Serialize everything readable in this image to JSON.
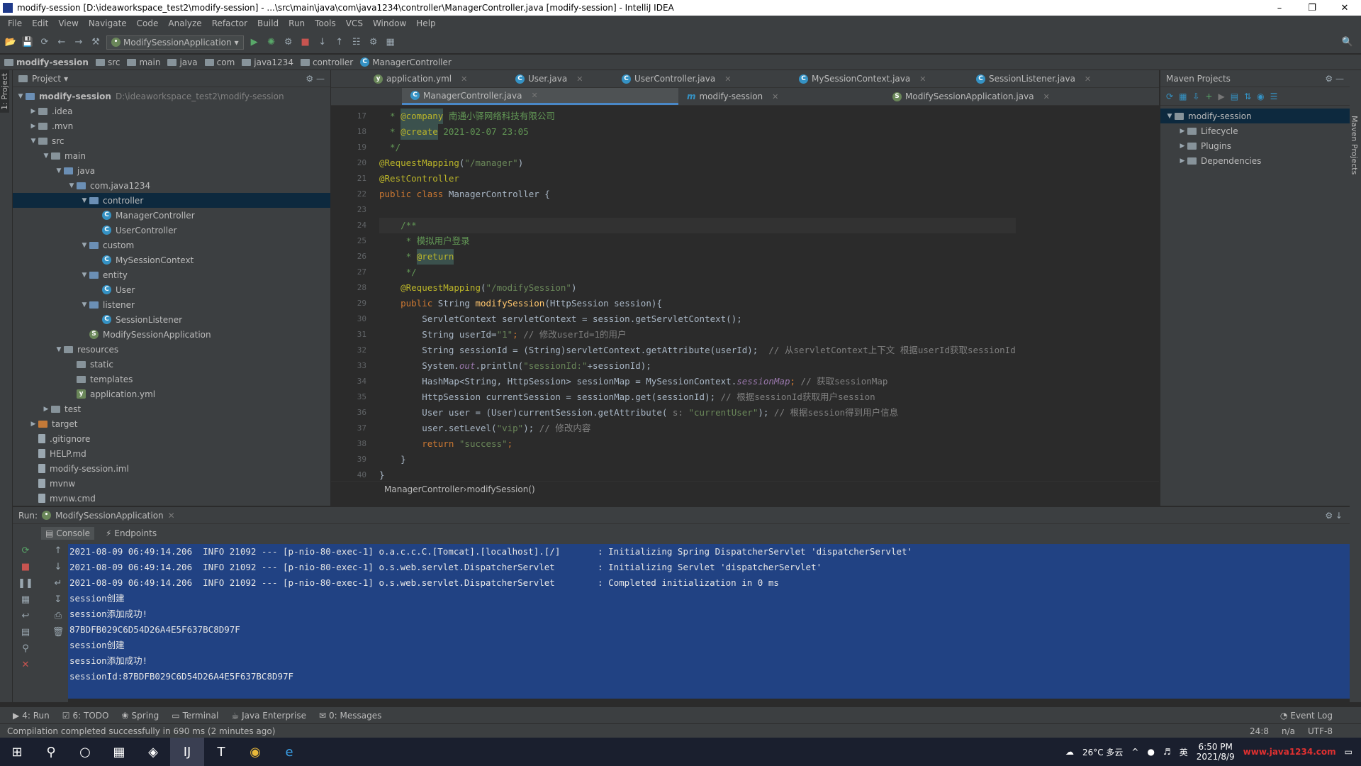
{
  "window": {
    "title": "modify-session [D:\\ideaworkspace_test2\\modify-session] - ...\\src\\main\\java\\com\\java1234\\controller\\ManagerController.java [modify-session] - IntelliJ IDEA"
  },
  "menu": [
    "File",
    "Edit",
    "View",
    "Navigate",
    "Code",
    "Analyze",
    "Refactor",
    "Build",
    "Run",
    "Tools",
    "VCS",
    "Window",
    "Help"
  ],
  "toolbar": {
    "run_config": "ModifySessionApplication"
  },
  "breadcrumbs": [
    "modify-session",
    "src",
    "main",
    "java",
    "com",
    "java1234",
    "controller",
    "ManagerController"
  ],
  "project": {
    "title": "Project",
    "tree": [
      {
        "label": "modify-session",
        "extra": "D:\\ideaworkspace_test2\\modify-session",
        "depth": 0,
        "type": "module",
        "open": true
      },
      {
        "label": ".idea",
        "depth": 1,
        "type": "folder",
        "open": false
      },
      {
        "label": ".mvn",
        "depth": 1,
        "type": "folder",
        "open": false
      },
      {
        "label": "src",
        "depth": 1,
        "type": "folder",
        "open": true
      },
      {
        "label": "main",
        "depth": 2,
        "type": "folder",
        "open": true
      },
      {
        "label": "java",
        "depth": 3,
        "type": "folder",
        "open": true
      },
      {
        "label": "com.java1234",
        "depth": 4,
        "type": "folder",
        "open": true
      },
      {
        "label": "controller",
        "depth": 5,
        "type": "folder",
        "open": true,
        "selected": true
      },
      {
        "label": "ManagerController",
        "depth": 6,
        "type": "class"
      },
      {
        "label": "UserController",
        "depth": 6,
        "type": "class"
      },
      {
        "label": "custom",
        "depth": 5,
        "type": "folder",
        "open": true
      },
      {
        "label": "MySessionContext",
        "depth": 6,
        "type": "class"
      },
      {
        "label": "entity",
        "depth": 5,
        "type": "folder",
        "open": true
      },
      {
        "label": "User",
        "depth": 6,
        "type": "class"
      },
      {
        "label": "listener",
        "depth": 5,
        "type": "folder",
        "open": true
      },
      {
        "label": "SessionListener",
        "depth": 6,
        "type": "class"
      },
      {
        "label": "ModifySessionApplication",
        "depth": 5,
        "type": "spring"
      },
      {
        "label": "resources",
        "depth": 3,
        "type": "folder",
        "open": true
      },
      {
        "label": "static",
        "depth": 4,
        "type": "folder"
      },
      {
        "label": "templates",
        "depth": 4,
        "type": "folder"
      },
      {
        "label": "application.yml",
        "depth": 4,
        "type": "yml"
      },
      {
        "label": "test",
        "depth": 2,
        "type": "folder",
        "open": false
      },
      {
        "label": "target",
        "depth": 1,
        "type": "target",
        "open": false
      },
      {
        "label": ".gitignore",
        "depth": 1,
        "type": "file"
      },
      {
        "label": "HELP.md",
        "depth": 1,
        "type": "file"
      },
      {
        "label": "modify-session.iml",
        "depth": 1,
        "type": "file"
      },
      {
        "label": "mvnw",
        "depth": 1,
        "type": "file"
      },
      {
        "label": "mvnw.cmd",
        "depth": 1,
        "type": "file"
      }
    ]
  },
  "tabs_row1": [
    {
      "label": "application.yml",
      "active": false
    },
    {
      "label": "User.java",
      "active": false
    },
    {
      "label": "UserController.java",
      "active": false
    },
    {
      "label": "MySessionContext.java",
      "active": false
    },
    {
      "label": "SessionListener.java",
      "active": false
    }
  ],
  "tabs_row2": [
    {
      "label": "ManagerController.java",
      "active": true
    },
    {
      "label": "modify-session",
      "active": false
    },
    {
      "label": "ModifySessionApplication.java",
      "active": false
    }
  ],
  "code": {
    "line_numbers": [
      "17",
      "18",
      "19",
      "20",
      "21",
      "22",
      "23",
      "24",
      "25",
      "26",
      "27",
      "28",
      "29",
      "30",
      "31",
      "32",
      "33",
      "34",
      "35",
      "36",
      "37",
      "38",
      "39",
      "40"
    ],
    "lines": [
      [
        {
          "t": "  * ",
          "c": "doc"
        },
        {
          "t": "@company",
          "c": "an"
        },
        {
          "t": " 南通小驿网络科技有限公司",
          "c": "doc"
        }
      ],
      [
        {
          "t": "  * ",
          "c": "doc"
        },
        {
          "t": "@create",
          "c": "an"
        },
        {
          "t": " 2021-02-07 23:05",
          "c": "doc"
        }
      ],
      [
        {
          "t": "  */",
          "c": "doc"
        }
      ],
      [
        {
          "t": "@RequestMapping",
          "c": "an"
        },
        {
          "t": "(",
          "c": ""
        },
        {
          "t": "\"/manager\"",
          "c": "s"
        },
        {
          "t": ")",
          "c": ""
        }
      ],
      [
        {
          "t": "@RestController",
          "c": "an"
        }
      ],
      [
        {
          "t": "public class ",
          "c": "k"
        },
        {
          "t": "ManagerController {",
          "c": ""
        }
      ],
      [
        {
          "t": "",
          "c": ""
        }
      ],
      [
        {
          "t": "    /**",
          "c": "doc"
        }
      ],
      [
        {
          "t": "     * 模拟用户登录",
          "c": "doc"
        }
      ],
      [
        {
          "t": "     * ",
          "c": "doc"
        },
        {
          "t": "@return",
          "c": "an"
        }
      ],
      [
        {
          "t": "     */",
          "c": "doc"
        }
      ],
      [
        {
          "t": "    @RequestMapping",
          "c": "an"
        },
        {
          "t": "(",
          "c": ""
        },
        {
          "t": "\"/modifySession\"",
          "c": "s"
        },
        {
          "t": ")",
          "c": ""
        }
      ],
      [
        {
          "t": "    public ",
          "c": "k"
        },
        {
          "t": "String ",
          "c": ""
        },
        {
          "t": "modifySession",
          "c": "fn"
        },
        {
          "t": "(HttpSession session){",
          "c": ""
        }
      ],
      [
        {
          "t": "        ServletContext servletContext = session.getServletContext();",
          "c": ""
        }
      ],
      [
        {
          "t": "        String userId=",
          "c": ""
        },
        {
          "t": "\"1\"",
          "c": "s"
        },
        {
          "t": "; ",
          "c": "k"
        },
        {
          "t": "// 修改userId=1的用户",
          "c": "cm"
        }
      ],
      [
        {
          "t": "        String sessionId = (String)servletContext.getAttribute(userId);  ",
          "c": ""
        },
        {
          "t": "// 从servletContext上下文 根据userId获取sessionId",
          "c": "cm"
        }
      ],
      [
        {
          "t": "        System.",
          "c": ""
        },
        {
          "t": "out",
          "c": "it"
        },
        {
          "t": ".println(",
          "c": ""
        },
        {
          "t": "\"sessionId:\"",
          "c": "s"
        },
        {
          "t": "+sessionId);",
          "c": ""
        }
      ],
      [
        {
          "t": "        HashMap<String, HttpSession> sessionMap = MySessionContext.",
          "c": ""
        },
        {
          "t": "sessionMap",
          "c": "it"
        },
        {
          "t": "; ",
          "c": "k"
        },
        {
          "t": "// 获取sessionMap",
          "c": "cm"
        }
      ],
      [
        {
          "t": "        HttpSession currentSession = sessionMap.get(sessionId); ",
          "c": ""
        },
        {
          "t": "// 根据sessionId获取用户session",
          "c": "cm"
        }
      ],
      [
        {
          "t": "        User user = (User)currentSession.getAttribute( ",
          "c": ""
        },
        {
          "t": "s:",
          "c": "cm"
        },
        {
          "t": " \"currentUser\"",
          "c": "s"
        },
        {
          "t": "); ",
          "c": ""
        },
        {
          "t": "// 根据session得到用户信息",
          "c": "cm"
        }
      ],
      [
        {
          "t": "        user.setLevel(",
          "c": ""
        },
        {
          "t": "\"vip\"",
          "c": "s"
        },
        {
          "t": "); ",
          "c": ""
        },
        {
          "t": "// 修改内容",
          "c": "cm"
        }
      ],
      [
        {
          "t": "        return ",
          "c": "k"
        },
        {
          "t": "\"success\"",
          "c": "s"
        },
        {
          "t": ";",
          "c": "k"
        }
      ],
      [
        {
          "t": "    }",
          "c": ""
        }
      ],
      [
        {
          "t": "}",
          "c": ""
        }
      ]
    ]
  },
  "editor_breadcrumb": [
    "ManagerController",
    "modifySession()"
  ],
  "maven": {
    "title": "Maven Projects",
    "items": [
      {
        "label": "modify-session",
        "depth": 0,
        "selected": true
      },
      {
        "label": "Lifecycle",
        "depth": 1
      },
      {
        "label": "Plugins",
        "depth": 1
      },
      {
        "label": "Dependencies",
        "depth": 1
      }
    ]
  },
  "run": {
    "label": "Run:",
    "config": "ModifySessionApplication",
    "tabs": [
      "Console",
      "Endpoints"
    ],
    "console": [
      {
        "text": "2021-08-09 06:49:14.206  INFO 21092 --- [p-nio-80-exec-1] o.a.c.c.C.[Tomcat].[localhost].[/]       : Initializing Spring DispatcherServlet 'dispatcherServlet'",
        "sel": true
      },
      {
        "text": "2021-08-09 06:49:14.206  INFO 21092 --- [p-nio-80-exec-1] o.s.web.servlet.DispatcherServlet        : Initializing Servlet 'dispatcherServlet'",
        "sel": true
      },
      {
        "text": "2021-08-09 06:49:14.206  INFO 21092 --- [p-nio-80-exec-1] o.s.web.servlet.DispatcherServlet        : Completed initialization in 0 ms",
        "sel": true
      },
      {
        "text": "session创建",
        "sel": true
      },
      {
        "text": "session添加成功!",
        "sel": true
      },
      {
        "text": "87BDFB029C6D54D26A4E5F637BC8D97F",
        "sel": true
      },
      {
        "text": "session创建",
        "sel": true
      },
      {
        "text": "session添加成功!",
        "sel": true
      },
      {
        "text": "sessionId:87BDFB029C6D54D26A4E5F637BC8D97F",
        "sel": true
      }
    ]
  },
  "bottom_tools": [
    "4: Run",
    "6: TODO",
    "Spring",
    "Terminal",
    "Java Enterprise",
    "0: Messages"
  ],
  "event_log": "Event Log",
  "status": {
    "message": "Compilation completed successfully in 690 ms (2 minutes ago)",
    "position": "24:8",
    "na": "n/a",
    "encoding": "UTF-8"
  },
  "taskbar": {
    "weather": "26°C 多云",
    "ime": "英",
    "time": "6:50 PM",
    "date": "2021/8/9",
    "watermark": "www.java1234.com"
  },
  "colors": {
    "accent": "#4a88c7",
    "selection": "#214283",
    "bg": "#2b2b2b",
    "panel": "#3c3f41"
  }
}
